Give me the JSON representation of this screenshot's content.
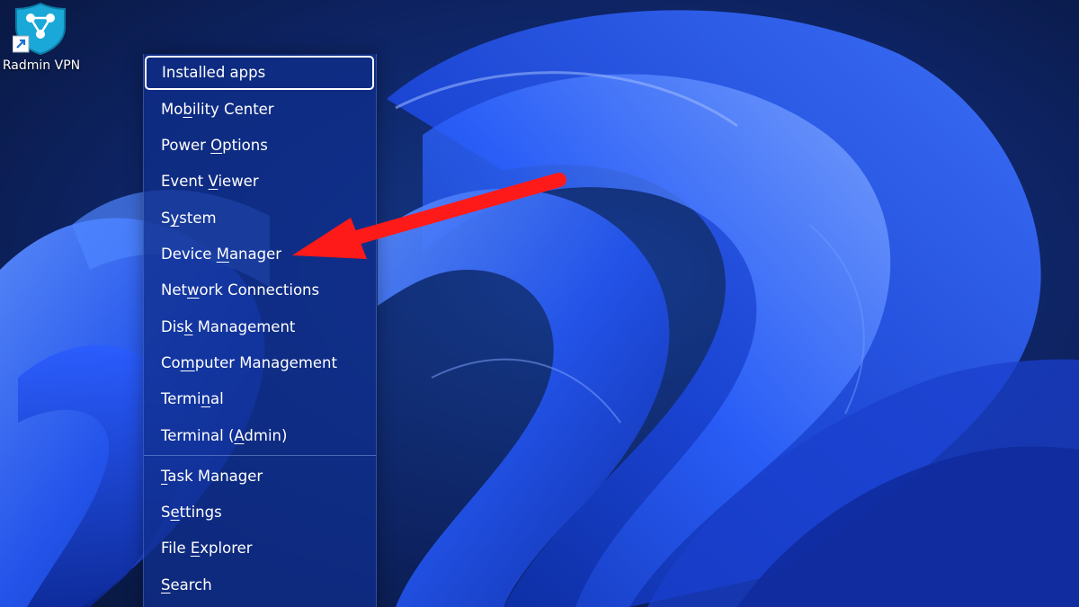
{
  "desktop": {
    "icons": [
      {
        "label": "Radmin VPN",
        "icon": "radmin-vpn-shield-icon"
      }
    ]
  },
  "context_menu": {
    "selected_index": 0,
    "items": [
      {
        "label": "Installed apps",
        "access_key_index": -1
      },
      {
        "label": "Mobility Center",
        "access_key_index": 2
      },
      {
        "label": "Power Options",
        "access_key_index": 6
      },
      {
        "label": "Event Viewer",
        "access_key_index": 6
      },
      {
        "label": "System",
        "access_key_index": 1
      },
      {
        "label": "Device Manager",
        "access_key_index": 7
      },
      {
        "label": "Network Connections",
        "access_key_index": 3
      },
      {
        "label": "Disk Management",
        "access_key_index": 3
      },
      {
        "label": "Computer Management",
        "access_key_index": 2
      },
      {
        "label": "Terminal",
        "access_key_index": 5
      },
      {
        "label": "Terminal (Admin)",
        "access_key_index": 10
      },
      {
        "label": "Task Manager",
        "access_key_index": 0
      },
      {
        "label": "Settings",
        "access_key_index": 1
      },
      {
        "label": "File Explorer",
        "access_key_index": 5
      },
      {
        "label": "Search",
        "access_key_index": 0
      }
    ]
  },
  "annotation": {
    "arrow_color": "#ff1a1a",
    "points_to": "Device Manager"
  },
  "colors": {
    "accent": "#1f4fe0",
    "menu_bg": "#102e8c"
  }
}
